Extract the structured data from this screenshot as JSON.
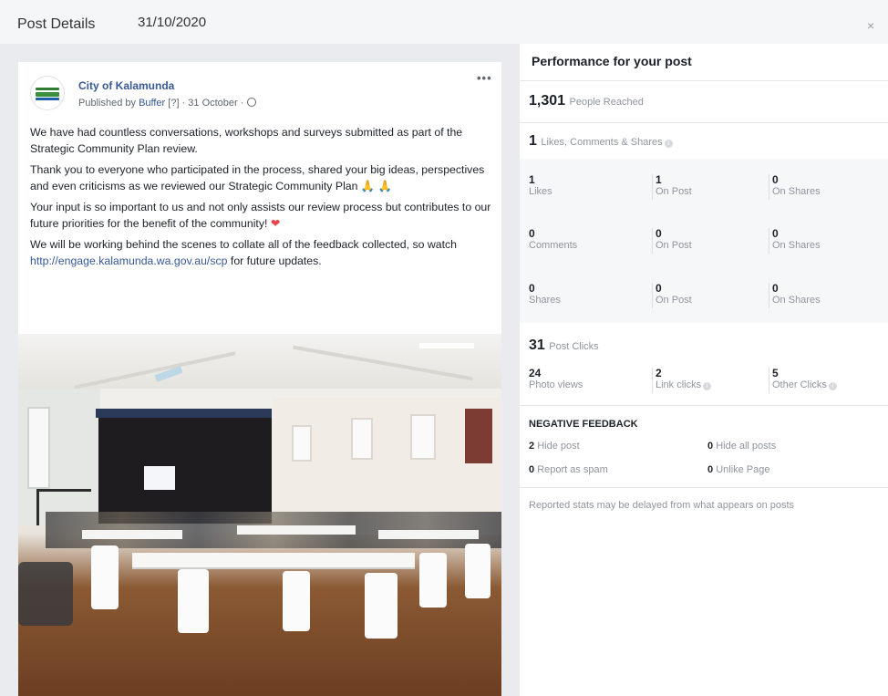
{
  "header": {
    "title": "Post Details",
    "date": "31/10/2020",
    "close": "×"
  },
  "post": {
    "page_name": "City of Kalamunda",
    "published_by_prefix": "Published by",
    "publisher": "Buffer",
    "publisher_suffix": " [?] · 31 October ·",
    "more": "•••",
    "paragraphs": {
      "p1": "We have had countless conversations, workshops and surveys submitted as part of the Strategic Community Plan review.",
      "p2": "Thank you to everyone who participated in the process, shared your big ideas, perspectives and even criticisms as we reviewed our Strategic Community Plan",
      "p3": "Your input is so important to us and not only assists our review process but contributes to our future priorities for the benefit of the community!",
      "p4_pre": "We will be working behind the scenes to collate all of the feedback collected, so watch",
      "p4_link": "http://engage.kalamunda.wa.gov.au/scp",
      "p4_post": "for future updates."
    },
    "emoji": {
      "pray": "🙏 🙏",
      "heart": "❤"
    }
  },
  "performance": {
    "title": "Performance for your post",
    "reached": {
      "value": "1,301",
      "label": "People Reached"
    },
    "engagement": {
      "value": "1",
      "label": "Likes, Comments & Shares"
    },
    "likes": [
      {
        "n": "1",
        "l": "Likes"
      },
      {
        "n": "1",
        "l": "On Post"
      },
      {
        "n": "0",
        "l": "On Shares"
      }
    ],
    "comments": [
      {
        "n": "0",
        "l": "Comments"
      },
      {
        "n": "0",
        "l": "On Post"
      },
      {
        "n": "0",
        "l": "On Shares"
      }
    ],
    "shares": [
      {
        "n": "0",
        "l": "Shares"
      },
      {
        "n": "0",
        "l": "On Post"
      },
      {
        "n": "0",
        "l": "On Shares"
      }
    ],
    "clicks": {
      "value": "31",
      "label": "Post Clicks"
    },
    "click_breakdown": [
      {
        "n": "24",
        "l": "Photo views"
      },
      {
        "n": "2",
        "l": "Link clicks"
      },
      {
        "n": "5",
        "l": "Other Clicks"
      }
    ],
    "negative": {
      "title": "NEGATIVE FEEDBACK",
      "hide_post": {
        "n": "2",
        "l": "Hide post"
      },
      "hide_all": {
        "n": "0",
        "l": "Hide all posts"
      },
      "spam": {
        "n": "0",
        "l": "Report as spam"
      },
      "unlike": {
        "n": "0",
        "l": "Unlike Page"
      }
    },
    "note": "Reported stats may be delayed from what appears on posts"
  },
  "colors": {
    "link": "#385898",
    "panel_bg": "#e9ebee",
    "stat_bg": "#f6f7f9"
  },
  "icons": [
    "close-icon",
    "globe-icon",
    "info-icon",
    "more-icon"
  ]
}
